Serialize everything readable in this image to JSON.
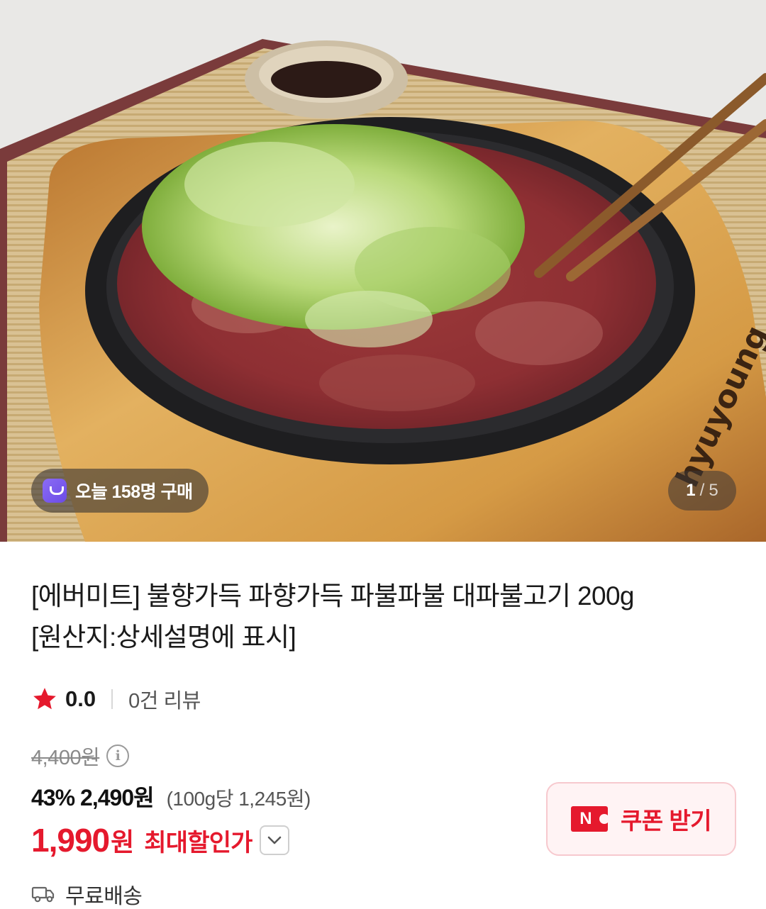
{
  "hero": {
    "today_badge": "오늘 158명 구매",
    "brand_mark": "hyuyoung",
    "page_current": "1",
    "page_separator": "/",
    "page_total": "5"
  },
  "product": {
    "title_line1": "[에버미트] 불향가득 파향가득 파불파불 대파불고기 200g",
    "title_line2": "[원산지:상세설명에 표시]"
  },
  "rating": {
    "score": "0.0",
    "reviews": "0건 리뷰"
  },
  "price": {
    "original": "4,400원",
    "info_icon": "i",
    "discount_rate": "43%",
    "sale_price": "2,490원",
    "unit_price": "(100g당 1,245원)",
    "max_discount_price": "1,990",
    "max_discount_won": "원",
    "max_discount_label": "최대할인가"
  },
  "coupon": {
    "badge": "N",
    "label": "쿠폰 받기"
  },
  "shipping": {
    "label": "무료배송"
  },
  "colors": {
    "accent_red": "#e5192d",
    "badge_purple": "#7b5cf0",
    "coupon_bg": "#fff3f4"
  },
  "icons": [
    "shopping-bag-icon",
    "star-icon",
    "info-icon",
    "chevron-down-icon",
    "n-coupon-icon",
    "truck-icon"
  ]
}
